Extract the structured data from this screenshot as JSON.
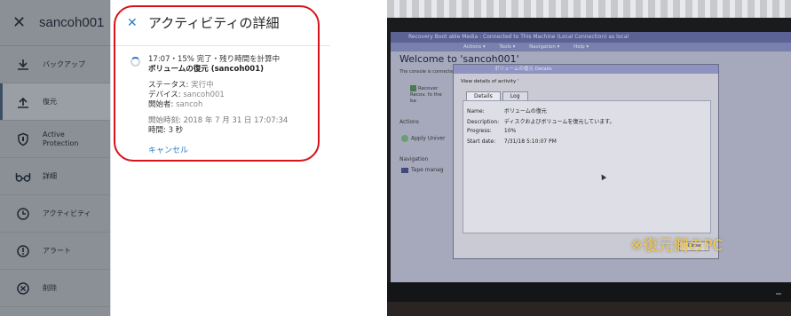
{
  "sidebar": {
    "close_icon": "close-icon",
    "title": "sancoh001",
    "items": [
      {
        "label": "バックアップ",
        "icon": "download-icon",
        "active": false
      },
      {
        "label": "復元",
        "icon": "restore-icon",
        "active": true
      },
      {
        "label_line1": "Active",
        "label_line2": "Protection",
        "icon": "shield-icon",
        "active": false
      },
      {
        "label": "詳細",
        "icon": "glasses-icon",
        "active": false
      },
      {
        "label": "アクティビティ",
        "icon": "clock-icon",
        "active": false
      },
      {
        "label": "アラート",
        "icon": "alert-icon",
        "active": false
      },
      {
        "label": "削除",
        "icon": "delete-icon",
        "active": false
      }
    ]
  },
  "panel": {
    "close_icon": "close-icon",
    "title": "アクティビティの詳細",
    "activity": {
      "status_line": "17:07・15% 完了・残り時間を計算中",
      "name": "ボリュームの復元 (sancoh001)",
      "status_label": "ステータス:",
      "status_value": "実行中",
      "device_label": "デバイス:",
      "device_value": "sancoh001",
      "initiator_label": "開始者:",
      "initiator_value": "sancoh",
      "start_time": "開始時刻: 2018 年 7 月 31 日 17:07:34",
      "duration": "時間: 3 秒",
      "cancel_label": "キャンセル"
    }
  },
  "photo": {
    "window_title": "Recovery Boot able Media : Connected to This Machine (Local Connection) as local",
    "menu": [
      "Actions ▾",
      "Tools ▾",
      "Navigation ▾",
      "Help ▾"
    ],
    "welcome": "Welcome to 'sancoh001'",
    "connected_text": "The console is connected to",
    "recover_label": "Recover",
    "recover_sub": "Recov. fo the ba",
    "actions_label": "Actions",
    "apply_label": "Apply Univer",
    "navigation_label": "Navigation",
    "tape_label": "Tape manag",
    "dialog": {
      "title": "ボリュームの復元 Details",
      "subtitle": "View details of activity '",
      "tabs": [
        "Details",
        "Log"
      ],
      "rows": [
        {
          "key": "Name:",
          "value": "ボリュームの復元"
        },
        {
          "key": "Description:",
          "value": "ディスクおよびボリュームを復元しています。"
        },
        {
          "key": "Progress:",
          "value": "10%"
        },
        {
          "key": "Start date:",
          "value": "7/31/18 5:10:07 PM"
        }
      ],
      "close_label": "Close"
    },
    "overlay_text": "※復元側のPC"
  },
  "colors": {
    "sidebar_bg": "#8b9096",
    "accent_blue": "#2c7fc8",
    "highlight_red": "#d6121a",
    "overlay_yellow": "#f2c94c"
  }
}
